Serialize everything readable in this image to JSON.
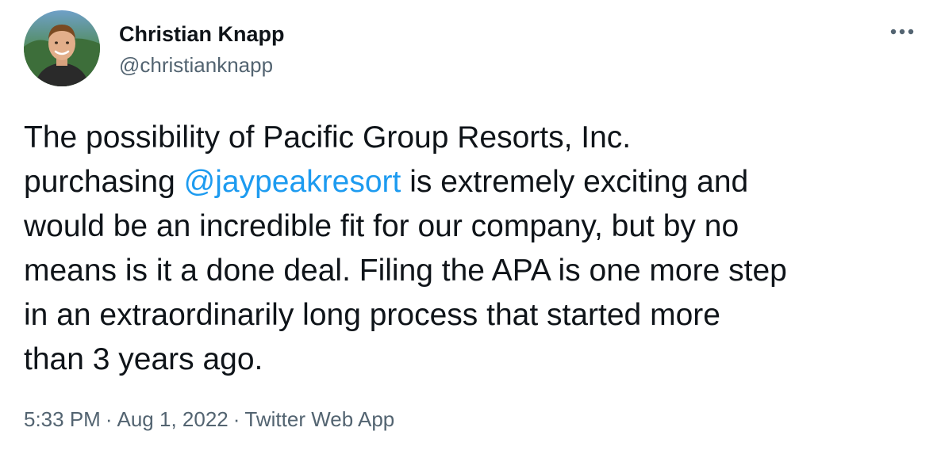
{
  "author": {
    "name": "Christian Knapp",
    "handle": "@christianknapp",
    "avatar_icon": "profile-photo"
  },
  "more_icon": "more-horizontal-icon",
  "tweet": {
    "lines": [
      {
        "before": "The possibility of Pacific Group Resorts, Inc.",
        "mention": "",
        "after": ""
      },
      {
        "before": "purchasing ",
        "mention": "@jaypeakresort",
        "after": " is extremely exciting and"
      },
      {
        "before": "would be an incredible fit for our company, but by no",
        "mention": "",
        "after": ""
      },
      {
        "before": "means is it a done deal. Filing the APA is one more step",
        "mention": "",
        "after": ""
      },
      {
        "before": "in an extraordinarily long process that started more",
        "mention": "",
        "after": ""
      },
      {
        "before": "than 3 years ago.",
        "mention": "",
        "after": ""
      }
    ]
  },
  "meta": {
    "time": "5:33 PM",
    "separator": "·",
    "date": "Aug 1, 2022",
    "source": "Twitter Web App"
  },
  "colors": {
    "text": "#0f1419",
    "secondary": "#536471",
    "link": "#1d9bf0"
  }
}
